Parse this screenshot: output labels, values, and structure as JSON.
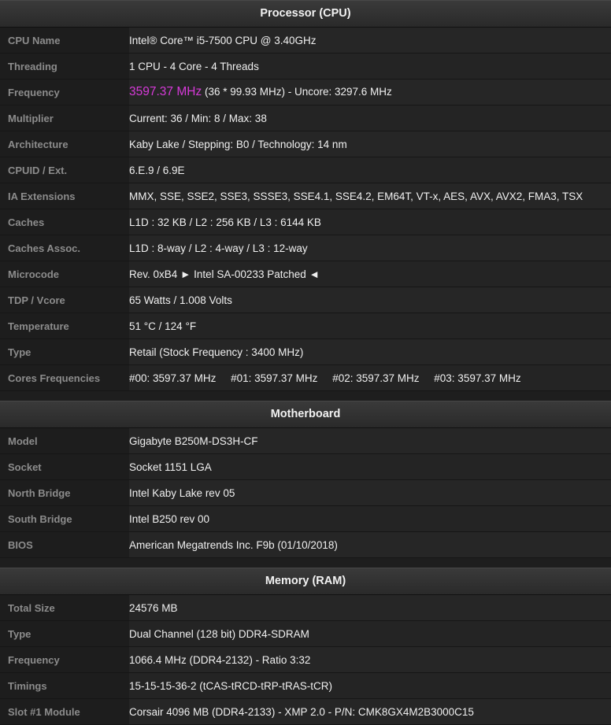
{
  "cpu": {
    "header": "Processor (CPU)",
    "rows": [
      {
        "label": "CPU Name",
        "value": "Intel® Core™ i5-7500 CPU @ 3.40GHz"
      },
      {
        "label": "Threading",
        "value": "1 CPU - 4 Core - 4 Threads"
      },
      {
        "label": "Frequency",
        "value": ""
      },
      {
        "label": "Multiplier",
        "value": "Current: 36 / Min: 8 / Max: 38"
      },
      {
        "label": "Architecture",
        "value": "Kaby Lake / Stepping: B0 / Technology: 14 nm"
      },
      {
        "label": "CPUID / Ext.",
        "value": "6.E.9 / 6.9E"
      },
      {
        "label": "IA Extensions",
        "value": "MMX, SSE, SSE2, SSE3, SSSE3, SSE4.1, SSE4.2, EM64T, VT-x, AES, AVX, AVX2, FMA3, TSX"
      },
      {
        "label": "Caches",
        "value": "L1D : 32 KB / L2 : 256 KB / L3 : 6144 KB"
      },
      {
        "label": "Caches Assoc.",
        "value": "L1D : 8-way / L2 : 4-way / L3 : 12-way"
      },
      {
        "label": "Microcode",
        "value": "Rev. 0xB4   ► Intel SA-00233 Patched ◄"
      },
      {
        "label": "TDP / Vcore",
        "value": "65 Watts / 1.008 Volts"
      },
      {
        "label": "Temperature",
        "value": "51 °C / 124 °F"
      },
      {
        "label": "Type",
        "value": "Retail (Stock Frequency : 3400 MHz)"
      },
      {
        "label": "Cores Frequencies",
        "value": ""
      }
    ],
    "frequency_main": "3597.37 MHz",
    "frequency_rest": " (36 * 99.93 MHz) - Uncore: 3297.6 MHz",
    "cores": [
      "#00: 3597.37 MHz",
      "#01: 3597.37 MHz",
      "#02: 3597.37 MHz",
      "#03: 3597.37 MHz"
    ]
  },
  "motherboard": {
    "header": "Motherboard",
    "rows": [
      {
        "label": "Model",
        "value": "Gigabyte B250M-DS3H-CF"
      },
      {
        "label": "Socket",
        "value": "Socket 1151 LGA"
      },
      {
        "label": "North Bridge",
        "value": "Intel Kaby Lake rev 05"
      },
      {
        "label": "South Bridge",
        "value": "Intel B250 rev 00"
      },
      {
        "label": "BIOS",
        "value": "American Megatrends Inc. F9b (01/10/2018)"
      }
    ]
  },
  "memory": {
    "header": "Memory (RAM)",
    "rows": [
      {
        "label": "Total Size",
        "value": "24576 MB"
      },
      {
        "label": "Type",
        "value": "Dual Channel (128 bit) DDR4-SDRAM"
      },
      {
        "label": "Frequency",
        "value": "1066.4 MHz (DDR4-2132) - Ratio 3:32"
      },
      {
        "label": "Timings",
        "value": "15-15-15-36-2 (tCAS-tRCD-tRP-tRAS-tCR)"
      },
      {
        "label": "Slot #1 Module",
        "value": "Corsair 4096 MB (DDR4-2133) - XMP 2.0 - P/N: CMK8GX4M2B3000C15"
      }
    ]
  },
  "colors": {
    "frequency_accent": "#d63ad8"
  }
}
